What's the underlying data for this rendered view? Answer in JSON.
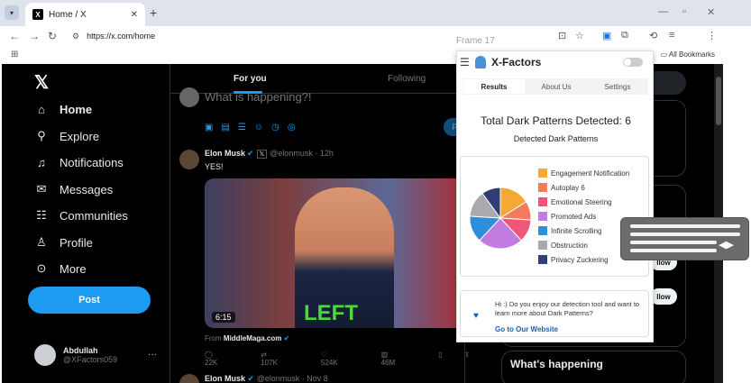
{
  "browser": {
    "tab_title": "Home / X",
    "url": "https://x.com/home",
    "bookmarks_label": "All Bookmarks",
    "frame_label": "Frame 17"
  },
  "x": {
    "nav": [
      {
        "label": "Home",
        "icon": "home-icon"
      },
      {
        "label": "Explore",
        "icon": "search-icon"
      },
      {
        "label": "Notifications",
        "icon": "bell-icon"
      },
      {
        "label": "Messages",
        "icon": "mail-icon"
      },
      {
        "label": "Communities",
        "icon": "communities-icon"
      },
      {
        "label": "Profile",
        "icon": "person-icon"
      },
      {
        "label": "More",
        "icon": "more-icon"
      }
    ],
    "post_button": "Post",
    "account": {
      "name": "Abdullah",
      "handle": "@XFactors059"
    },
    "feed_tabs": [
      "For you",
      "Following"
    ],
    "compose_placeholder": "What is happening?!",
    "compose_post_button": "Po",
    "tweet": {
      "author": "Elon Musk",
      "handle_time": "@elonmusk · 12h",
      "text": "YES!",
      "video_duration": "6:15",
      "video_caption": "LEFT",
      "from_label": "From",
      "from_source": "MiddleMaga.com",
      "replies": "22K",
      "reposts": "107K",
      "likes": "524K",
      "views": "46M"
    },
    "tweet2": {
      "author": "Elon Musk",
      "handle_time": "@elonmusk · Nov 8"
    },
    "follow_label": "llow",
    "whats_happening": "What's happening"
  },
  "extension": {
    "title": "X-Factors",
    "tabs": [
      "Results",
      "About Us",
      "Settings"
    ],
    "active_tab": "Results",
    "total_label": "Total Dark Patterns Detected: 6",
    "chart_heading": "Detected Dark Patterns",
    "message": "Hi :) Do you enjoy our detection tool and want to learn more about Dark Patterns?",
    "link": "Go to Our Website"
  },
  "chart_data": {
    "type": "pie",
    "title": "Detected Dark Patterns",
    "series": [
      {
        "name": "Engagement Notification",
        "color": "#f5a833"
      },
      {
        "name": "Autoplay 6",
        "color": "#f47a5c"
      },
      {
        "name": "Emotional Steering",
        "color": "#f0567a"
      },
      {
        "name": "Promoted Ads",
        "color": "#c27be0"
      },
      {
        "name": "Infinite Scrolling",
        "color": "#2d8fdc"
      },
      {
        "name": "Obstruction",
        "color": "#a9a9ae"
      },
      {
        "name": "Privacy Zuckering",
        "color": "#2f3f75"
      }
    ],
    "values": [
      0.16,
      0.1,
      0.12,
      0.24,
      0.14,
      0.14,
      0.1
    ]
  }
}
